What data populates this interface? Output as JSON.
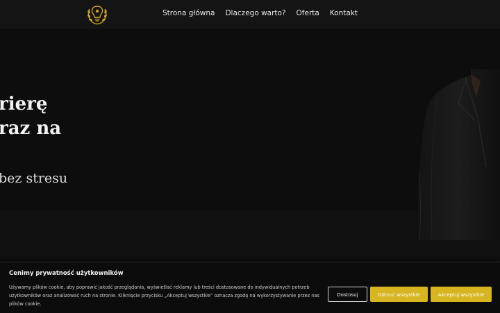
{
  "nav": {
    "items": [
      {
        "label": "Strona główna"
      },
      {
        "label": "Dlaczego warto?"
      },
      {
        "label": "Oferta"
      },
      {
        "label": "Kontakt"
      }
    ]
  },
  "hero": {
    "headline_line1": "rierę",
    "headline_line2": "raz na",
    "tagline": "bez stresu"
  },
  "cookie_banner": {
    "title": "Cenimy prywatność użytkowników",
    "text": "Używamy plików cookie, aby poprawić jakość przeglądania, wyświetlać reklamy lub treści dostosowane do indywidualnych potrzeb użytkowników oraz analizować ruch na stronie. Kliknięcie przycisku „Akceptuj wszystkie” oznacza zgodę na wykorzystywanie przez nas plików cookie.",
    "customize_label": "Dostosuj",
    "reject_label": "Odrzuć wszystkie",
    "accept_label": "Akceptuj wszystkie"
  },
  "colors": {
    "accent_gold": "#d7b521",
    "background": "#111111"
  }
}
